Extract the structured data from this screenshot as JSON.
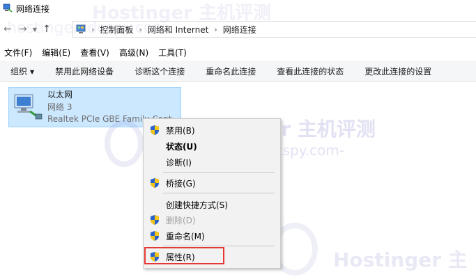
{
  "window": {
    "title": "网络连接",
    "icon": "network-connections-icon"
  },
  "address": {
    "crumbs": [
      "控制面板",
      "网络和 Internet",
      "网络连接"
    ],
    "back_icon": "back-arrow-icon",
    "forward_icon": "forward-arrow-icon",
    "recent_icon": "chevron-down-icon",
    "up_icon": "up-arrow-icon"
  },
  "menu": [
    "文件(F)",
    "编辑(E)",
    "查看(V)",
    "高级(N)",
    "工具(T)"
  ],
  "commands": {
    "organize": "组织",
    "items": [
      "禁用此网络设备",
      "诊断这个连接",
      "重命名此连接",
      "查看此连接的状态",
      "更改此连接的设置"
    ]
  },
  "connection": {
    "name": "以太网",
    "network": "网络 3",
    "adapter": "Realtek PCIe GBE Family Cont...",
    "selected_bg": "#cce8ff"
  },
  "context_menu": {
    "items": [
      {
        "label": "禁用(B)",
        "shield": true
      },
      {
        "label": "状态(U)",
        "shield": false,
        "bold": true
      },
      {
        "label": "诊断(I)",
        "shield": false
      },
      {
        "label": "桥接(G)",
        "shield": true
      },
      {
        "label": "创建快捷方式(S)",
        "shield": false
      },
      {
        "label": "删除(D)",
        "shield": true,
        "disabled": true
      },
      {
        "label": "重命名(M)",
        "shield": true
      },
      {
        "label": "属性(R)",
        "shield": true
      }
    ],
    "highlight_color": "#e53935"
  },
  "watermark": {
    "brand": "Hostinger 主机评测",
    "site": "-hostinger.idcspy.com-",
    "brand_short": "Hostinger 主"
  }
}
